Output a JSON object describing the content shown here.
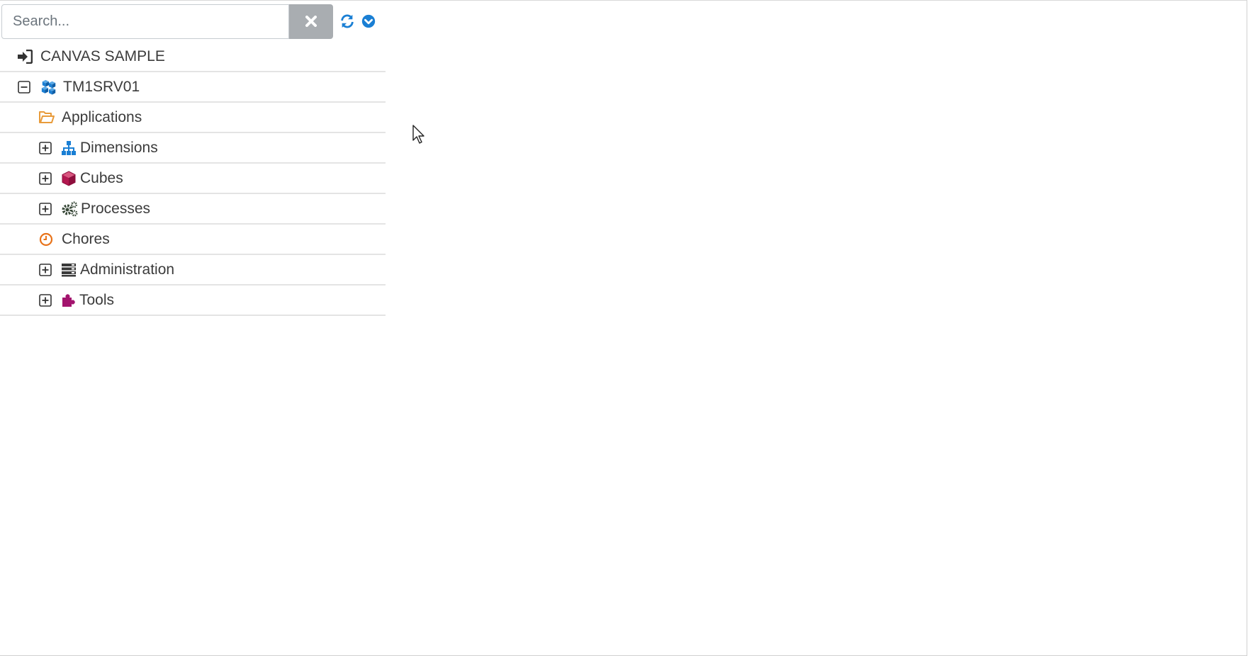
{
  "search": {
    "placeholder": "Search..."
  },
  "tree": {
    "root_label": "CANVAS SAMPLE",
    "server_label": "TM1SRV01",
    "items": [
      {
        "label": "Applications",
        "icon": "folder-open-icon"
      },
      {
        "label": "Dimensions",
        "icon": "sitemap-icon"
      },
      {
        "label": "Cubes",
        "icon": "cube-icon"
      },
      {
        "label": "Processes",
        "icon": "gears-icon"
      },
      {
        "label": "Chores",
        "icon": "clock-icon"
      },
      {
        "label": "Administration",
        "icon": "server-icon"
      },
      {
        "label": "Tools",
        "icon": "puzzle-icon"
      }
    ]
  },
  "colors": {
    "accent_blue": "#1a7fd4",
    "folder_orange": "#e89b3b",
    "cube_red": "#b3174f",
    "chores_orange": "#e8731a",
    "tools_magenta": "#a3146e",
    "clear_button_gray": "#a9adb1"
  }
}
